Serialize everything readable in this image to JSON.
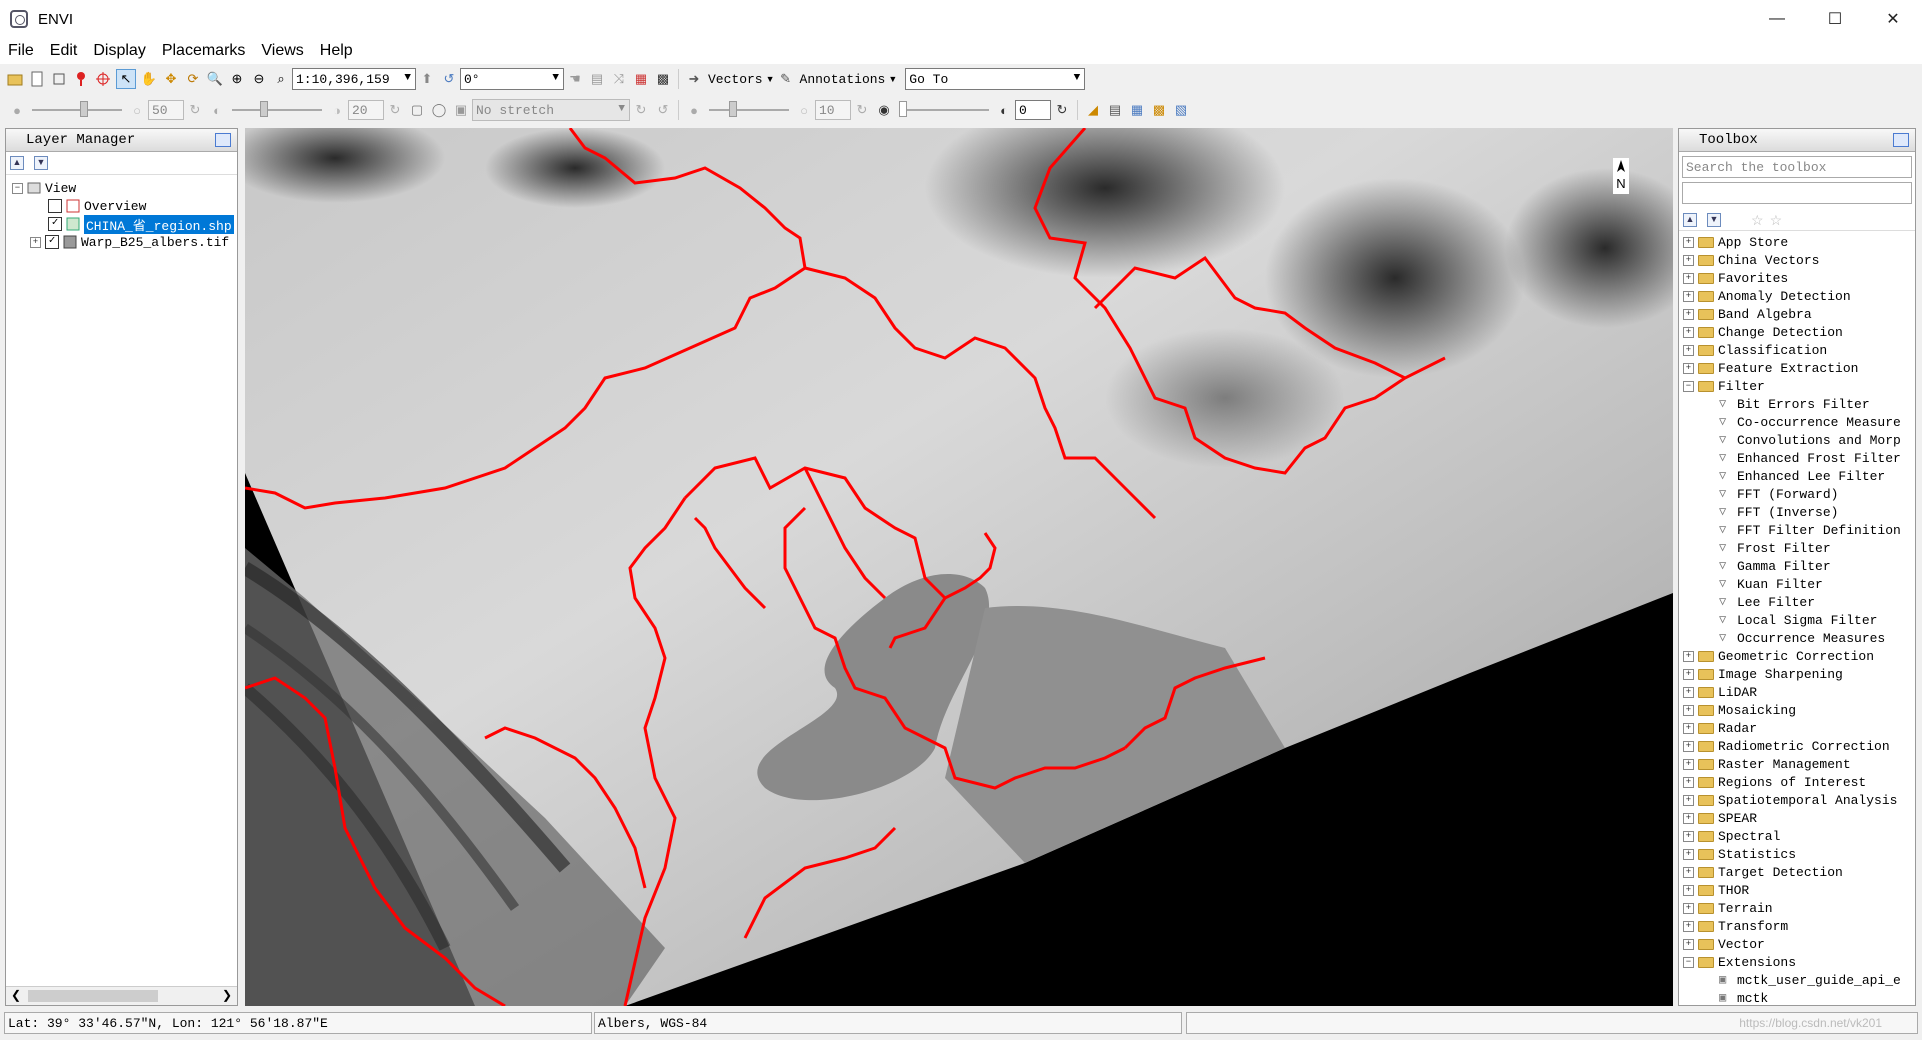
{
  "window": {
    "title": "ENVI",
    "icon": "envi-logo-icon"
  },
  "menu": [
    "File",
    "Edit",
    "Display",
    "Placemarks",
    "Views",
    "Help"
  ],
  "toolbar": {
    "scale": "1:10,396,159",
    "rotation": "0°",
    "vectors_label": "Vectors",
    "annotations_label": "Annotations",
    "goto_placeholder": "Go To",
    "brightness": "50",
    "contrast": "20",
    "stretch": "No stretch",
    "sharpen": "10",
    "transparency": "0"
  },
  "layer_manager": {
    "title": "Layer Manager",
    "root": "View",
    "items": [
      {
        "label": "Overview",
        "checked": false
      },
      {
        "label": "CHINA_省_region.shp",
        "checked": true,
        "selected": true
      },
      {
        "label": "Warp_B25_albers.tif",
        "checked": true
      }
    ]
  },
  "toolbox": {
    "title": "Toolbox",
    "search_placeholder": "Search the toolbox",
    "folders_top": [
      "App Store",
      "China Vectors",
      "Favorites",
      "Anomaly Detection",
      "Band Algebra",
      "Change Detection",
      "Classification",
      "Feature Extraction",
      "Filter"
    ],
    "filter_tools": [
      "Bit Errors Filter",
      "Co-occurrence Measure",
      "Convolutions and Morp",
      "Enhanced Frost Filter",
      "Enhanced Lee Filter",
      "FFT (Forward)",
      "FFT (Inverse)",
      "FFT Filter Definition",
      "Frost Filter",
      "Gamma Filter",
      "Kuan Filter",
      "Lee Filter",
      "Local Sigma Filter",
      "Occurrence Measures"
    ],
    "folders_bottom": [
      "Geometric Correction",
      "Image Sharpening",
      "LiDAR",
      "Mosaicking",
      "Radar",
      "Radiometric Correction",
      "Raster Management",
      "Regions of Interest",
      "Spatiotemporal Analysis",
      "SPEAR",
      "Spectral",
      "Statistics",
      "Target Detection",
      "THOR",
      "Terrain",
      "Transform",
      "Vector",
      "Extensions"
    ],
    "extensions": [
      "mctk_user_guide_api_e",
      "mctk"
    ]
  },
  "status": {
    "coords": "Lat: 39° 33′46.57″N, Lon: 121° 56′18.87″E",
    "projection": "Albers, WGS-84",
    "watermark": "https://blog.csdn.net/vk201"
  },
  "map": {
    "north_label": "N",
    "boundary_color": "#ff0000"
  }
}
